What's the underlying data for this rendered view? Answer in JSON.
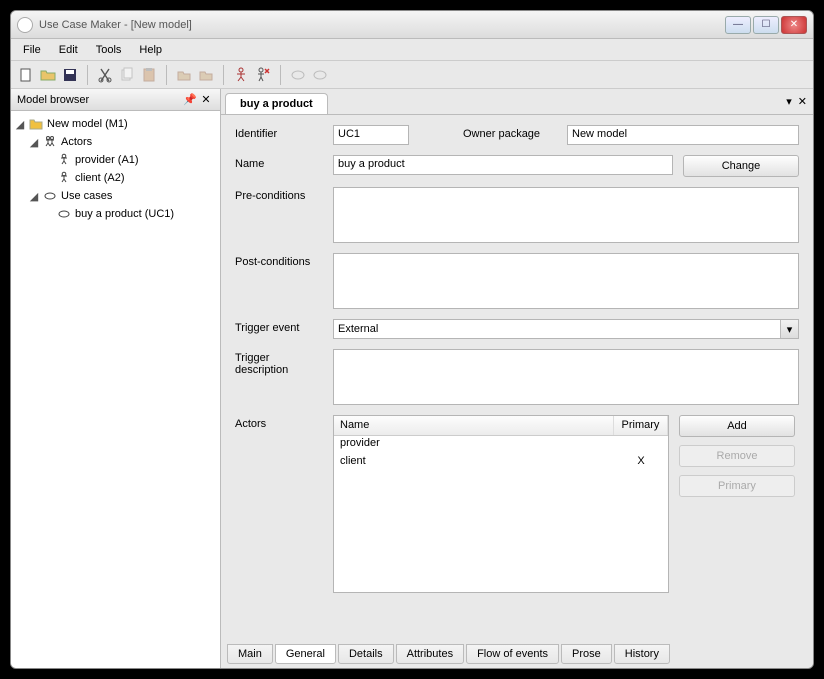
{
  "window": {
    "title": "Use Case Maker - [New model]"
  },
  "menubar": [
    "File",
    "Edit",
    "Tools",
    "Help"
  ],
  "sidebar": {
    "title": "Model browser",
    "tree": {
      "model": "New model (M1)",
      "actors": "Actors",
      "actor1": "provider (A1)",
      "actor2": "client (A2)",
      "usecases": "Use cases",
      "uc1": "buy a product (UC1)"
    }
  },
  "main": {
    "tab": "buy a product"
  },
  "form": {
    "labels": {
      "identifier": "Identifier",
      "owner_package": "Owner package",
      "name": "Name",
      "preconditions": "Pre-conditions",
      "postconditions": "Post-conditions",
      "trigger_event": "Trigger event",
      "trigger_description": "Trigger description",
      "actors": "Actors"
    },
    "values": {
      "identifier": "UC1",
      "owner_package": "New model",
      "name": "buy a product",
      "trigger_event": "External"
    },
    "buttons": {
      "change": "Change",
      "add": "Add",
      "remove": "Remove",
      "primary": "Primary"
    },
    "actors": {
      "cols": [
        "Name",
        "Primary"
      ],
      "rows": [
        {
          "name": "provider",
          "primary": ""
        },
        {
          "name": "client",
          "primary": "X"
        }
      ]
    }
  },
  "bottom_tabs": [
    "Main",
    "General",
    "Details",
    "Attributes",
    "Flow of events",
    "Prose",
    "History"
  ]
}
